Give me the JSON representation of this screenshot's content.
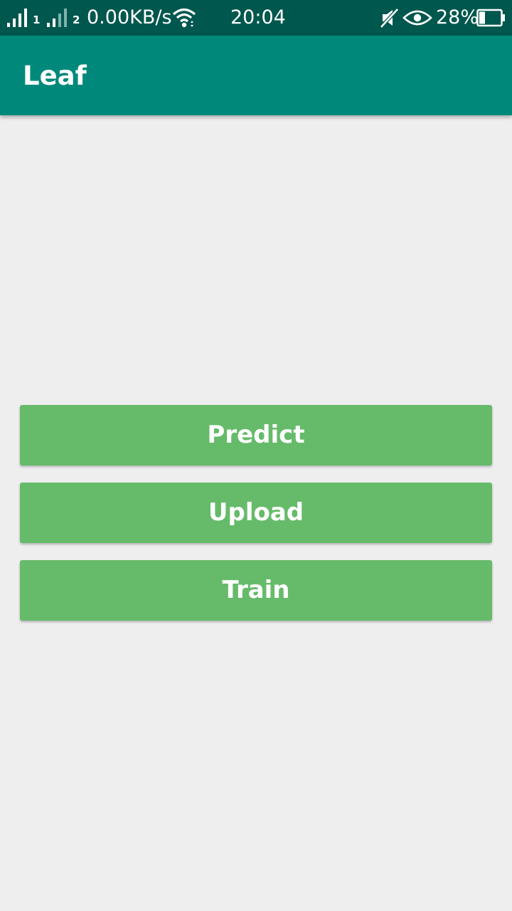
{
  "status_bar": {
    "sim1_label": "1",
    "sim2_label": "2",
    "network_speed": "0.00KB/s",
    "time": "20:04",
    "battery_percent": "28%",
    "icons": [
      "signal-icon",
      "wifi-icon",
      "mute-icon",
      "eye-icon",
      "battery-icon"
    ],
    "battery_level": 0.28
  },
  "app_bar": {
    "title": "Leaf",
    "color": "#00897b"
  },
  "buttons": [
    {
      "label": "Predict"
    },
    {
      "label": "Upload"
    },
    {
      "label": "Train"
    }
  ],
  "colors": {
    "status_bar": "#00574d",
    "app_bar": "#00897b",
    "button": "#66bb6a",
    "background": "#eeeeee"
  }
}
